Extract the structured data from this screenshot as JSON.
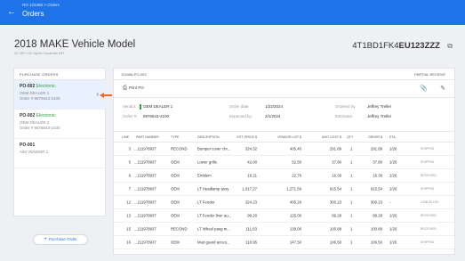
{
  "header": {
    "breadcrumb": "RO 123456 > Orders",
    "back_icon": "arrow-left-icon",
    "title": "Orders"
  },
  "vehicle": {
    "title": "2018 MAKE Vehicle Model",
    "subtitle": "4D SED 2.5L Hybrid Sequential MPI",
    "vin_prefix": "4T1BD1FK4",
    "vin_suffix": "EU123ZZZ",
    "copy_icon": "copy-icon"
  },
  "purchase_orders": {
    "header": "PURCHASE ORDERS",
    "items": [
      {
        "id": "PO-002",
        "status": "Electronic",
        "vendor": "OEM DEALER 1",
        "order": "Order # 9876543-2100",
        "selected": true
      },
      {
        "id": "PO-002",
        "status": "Electronic",
        "vendor": "OEM DEALER 2",
        "order": "Order # 9876543-2100",
        "selected": false
      },
      {
        "id": "PO-001",
        "status": "",
        "vendor": "A/M VENDOR 1",
        "order": "",
        "selected": false
      }
    ],
    "add_button": "Purchase Order"
  },
  "detail": {
    "id": "123456-PO-003",
    "status": "PARTIAL RECEIVE",
    "print_label": "Print PO",
    "meta": {
      "vendor_label": "Vendor:",
      "vendor": "OEM DEALER 1",
      "order_label": "Order #:",
      "order": "9876543-2100",
      "order_date_label": "Order date:",
      "order_date": "1/22/2024",
      "expected_label": "Expected by:",
      "expected": "2/1/2024",
      "ordered_by_label": "Ordered by:",
      "ordered_by": "Jeffrey Treller",
      "estimator_label": "Estimator:",
      "estimator": "Jeffrey Treller"
    },
    "columns": [
      "LINE",
      "PART NUMBER",
      "TYPE",
      "DESCRIPTION",
      "EST. PRICE $",
      "VENDOR LIST $",
      "UNIT COST $",
      "QTY",
      "ORDER $",
      "ETA"
    ],
    "rows": [
      {
        "line": "3",
        "part": "...211978937",
        "type": "RECOND",
        "desc": "Bumper cover chr...",
        "est": "324.32",
        "list": "405.40",
        "unit": "291.89",
        "qty": "1",
        "order": "291.89",
        "eta": "1/26",
        "status": "SHIPPED"
      },
      {
        "line": "5",
        "part": "...211978937",
        "type": "OEM",
        "desc": "Lower grille",
        "est": "42.00",
        "list": "52.50",
        "unit": "37.80",
        "qty": "1",
        "order": "37.80",
        "eta": "1/26",
        "status": "SHIPPED"
      },
      {
        "line": "6",
        "part": "...211978937",
        "type": "OEM",
        "desc": "Emblem",
        "est": "18.21",
        "list": "22.76",
        "unit": "16.39",
        "qty": "1",
        "order": "16.39",
        "eta": "1/26",
        "status": "RECEIVED"
      },
      {
        "line": "7",
        "part": "...211978937",
        "type": "OEM",
        "desc": "LT Headlamp assy",
        "est": "1,017.27",
        "list": "1,271.59",
        "unit": "915.54",
        "qty": "1",
        "order": "915.54",
        "eta": "1/26",
        "status": "SHIPPED"
      },
      {
        "line": "12",
        "part": "...211978937",
        "type": "OEM",
        "desc": "LT Fender",
        "est": "324.23",
        "list": "405.29",
        "unit": "300.23",
        "qty": "1",
        "order": "300.23",
        "eta": "-",
        "status": "CANCELLED"
      },
      {
        "line": "13",
        "part": "...211978937",
        "type": "OEM",
        "desc": "LT Fender liner au...",
        "est": "99.20",
        "list": "125.00",
        "unit": "89.28",
        "qty": "1",
        "order": "89.28",
        "eta": "1/26",
        "status": "RECEIVED"
      },
      {
        "line": "15",
        "part": "...211978937",
        "type": "RECOND",
        "desc": "LT Wheel pasg m...",
        "est": "111.63",
        "list": "139.00",
        "unit": "100.89",
        "qty": "1",
        "order": "100.89",
        "eta": "1/26",
        "status": "RECEIVED"
      },
      {
        "line": "16",
        "part": "...211978937",
        "type": "OEM",
        "desc": "Mud guard acces...",
        "est": "118.95",
        "list": "147.50",
        "unit": "106.50",
        "qty": "1",
        "order": "106.50",
        "eta": "1/26",
        "status": "SHIPPED"
      }
    ]
  },
  "colors": {
    "primary": "#1e73e8",
    "electronic": "#2ea043",
    "arrow": "#f06a26"
  }
}
